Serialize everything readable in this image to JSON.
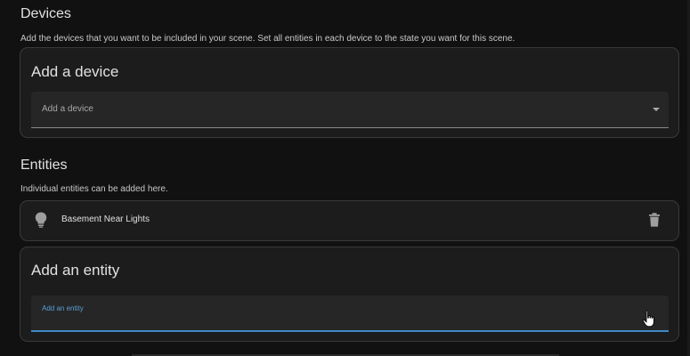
{
  "devices": {
    "title": "Devices",
    "description": "Add the devices that you want to be included in your scene. Set all entities in each device to the state you want for this scene.",
    "add_device_card": {
      "title": "Add a device",
      "field_label": "Add a device"
    }
  },
  "entities": {
    "title": "Entities",
    "description": "Individual entities can be added here.",
    "items": [
      {
        "name": "Basement Near Lights",
        "icon": "lightbulb-icon"
      }
    ],
    "add_entity_card": {
      "title": "Add an entity",
      "field_label": "Add an entity"
    }
  },
  "colors": {
    "background": "#111111",
    "card": "#1c1c1c",
    "field": "#262626",
    "accent": "#3f88c5"
  }
}
